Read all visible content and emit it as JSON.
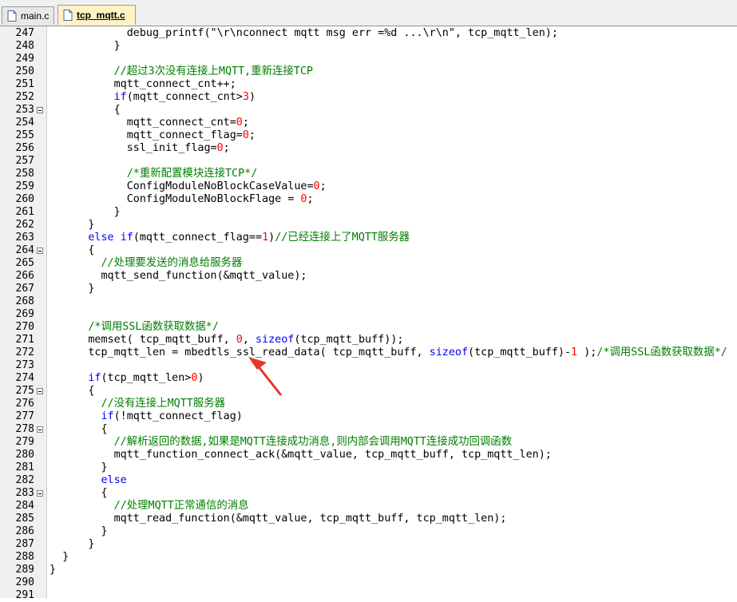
{
  "tabs": [
    {
      "label": "main.c",
      "icon": "file-icon",
      "active": false
    },
    {
      "label": "tcp_mqtt.c",
      "icon": "file-icon",
      "active": true
    }
  ],
  "colors": {
    "keyword": "#0000ff",
    "number": "#ff0000",
    "comment": "#008000",
    "arrow": "#e8332c"
  },
  "lines": [
    {
      "n": "247",
      "fold": false,
      "t": [
        [
          "            debug_printf(\"\\r\\nconnect mqtt msg err =%d ...\\r\\n\", tcp_mqtt_len);",
          ""
        ]
      ]
    },
    {
      "n": "248",
      "fold": false,
      "t": [
        [
          "          }",
          ""
        ]
      ]
    },
    {
      "n": "249",
      "fold": false,
      "t": [
        [
          "",
          ""
        ]
      ]
    },
    {
      "n": "250",
      "fold": false,
      "t": [
        [
          "          ",
          ""
        ],
        [
          "//超过3次没有连接上MQTT,重新连接TCP",
          "cm"
        ]
      ]
    },
    {
      "n": "251",
      "fold": false,
      "t": [
        [
          "          mqtt_connect_cnt++;",
          ""
        ]
      ]
    },
    {
      "n": "252",
      "fold": false,
      "t": [
        [
          "          ",
          ""
        ],
        [
          "if",
          "kw"
        ],
        [
          "(mqtt_connect_cnt>",
          ""
        ],
        [
          "3",
          "num"
        ],
        [
          ")",
          ""
        ]
      ]
    },
    {
      "n": "253",
      "fold": true,
      "t": [
        [
          "          {",
          ""
        ]
      ]
    },
    {
      "n": "254",
      "fold": false,
      "t": [
        [
          "            mqtt_connect_cnt=",
          ""
        ],
        [
          "0",
          "num"
        ],
        [
          ";",
          ""
        ]
      ]
    },
    {
      "n": "255",
      "fold": false,
      "t": [
        [
          "            mqtt_connect_flag=",
          ""
        ],
        [
          "0",
          "num"
        ],
        [
          ";",
          ""
        ]
      ]
    },
    {
      "n": "256",
      "fold": false,
      "t": [
        [
          "            ssl_init_flag=",
          ""
        ],
        [
          "0",
          "num"
        ],
        [
          ";",
          ""
        ]
      ]
    },
    {
      "n": "257",
      "fold": false,
      "t": [
        [
          "",
          ""
        ]
      ]
    },
    {
      "n": "258",
      "fold": false,
      "t": [
        [
          "            ",
          ""
        ],
        [
          "/*重新配置模块连接TCP*/",
          "cm"
        ]
      ]
    },
    {
      "n": "259",
      "fold": false,
      "t": [
        [
          "            ConfigModuleNoBlockCaseValue=",
          ""
        ],
        [
          "0",
          "num"
        ],
        [
          ";",
          ""
        ]
      ]
    },
    {
      "n": "260",
      "fold": false,
      "t": [
        [
          "            ConfigModuleNoBlockFlage = ",
          ""
        ],
        [
          "0",
          "num"
        ],
        [
          ";",
          ""
        ]
      ]
    },
    {
      "n": "261",
      "fold": false,
      "t": [
        [
          "          }",
          ""
        ]
      ]
    },
    {
      "n": "262",
      "fold": false,
      "t": [
        [
          "      }",
          ""
        ]
      ]
    },
    {
      "n": "263",
      "fold": false,
      "t": [
        [
          "      ",
          ""
        ],
        [
          "else",
          "kw"
        ],
        [
          " ",
          ""
        ],
        [
          "if",
          "kw"
        ],
        [
          "(mqtt_connect_flag==",
          ""
        ],
        [
          "1",
          "num"
        ],
        [
          ")",
          ""
        ],
        [
          "//已经连接上了MQTT服务器",
          "cm"
        ]
      ]
    },
    {
      "n": "264",
      "fold": true,
      "t": [
        [
          "      {",
          ""
        ]
      ]
    },
    {
      "n": "265",
      "fold": false,
      "t": [
        [
          "        ",
          ""
        ],
        [
          "//处理要发送的消息给服务器",
          "cm"
        ]
      ]
    },
    {
      "n": "266",
      "fold": false,
      "t": [
        [
          "        mqtt_send_function(&mqtt_value);",
          ""
        ]
      ]
    },
    {
      "n": "267",
      "fold": false,
      "t": [
        [
          "      }",
          ""
        ]
      ]
    },
    {
      "n": "268",
      "fold": false,
      "t": [
        [
          "",
          ""
        ]
      ]
    },
    {
      "n": "269",
      "fold": false,
      "t": [
        [
          "",
          ""
        ]
      ]
    },
    {
      "n": "270",
      "fold": false,
      "t": [
        [
          "      ",
          ""
        ],
        [
          "/*调用SSL函数获取数据*/",
          "cm"
        ]
      ]
    },
    {
      "n": "271",
      "fold": false,
      "t": [
        [
          "      memset( tcp_mqtt_buff, ",
          ""
        ],
        [
          "0",
          "num"
        ],
        [
          ", ",
          ""
        ],
        [
          "sizeof",
          "kw"
        ],
        [
          "(tcp_mqtt_buff));",
          ""
        ]
      ]
    },
    {
      "n": "272",
      "fold": false,
      "t": [
        [
          "      tcp_mqtt_len = mbedtls_ssl_read_data( tcp_mqtt_buff, ",
          ""
        ],
        [
          "sizeof",
          "kw"
        ],
        [
          "(tcp_mqtt_buff)-",
          ""
        ],
        [
          "1",
          "num"
        ],
        [
          " );",
          ""
        ],
        [
          "/*调用SSL函数获取数据*/",
          "cm"
        ]
      ]
    },
    {
      "n": "273",
      "fold": false,
      "t": [
        [
          "",
          ""
        ]
      ]
    },
    {
      "n": "274",
      "fold": false,
      "t": [
        [
          "      ",
          ""
        ],
        [
          "if",
          "kw"
        ],
        [
          "(tcp_mqtt_len>",
          ""
        ],
        [
          "0",
          "num"
        ],
        [
          ")",
          ""
        ]
      ]
    },
    {
      "n": "275",
      "fold": true,
      "t": [
        [
          "      {",
          ""
        ]
      ]
    },
    {
      "n": "276",
      "fold": false,
      "t": [
        [
          "        ",
          ""
        ],
        [
          "//没有连接上MQTT服务器",
          "cm"
        ]
      ]
    },
    {
      "n": "277",
      "fold": false,
      "t": [
        [
          "        ",
          ""
        ],
        [
          "if",
          "kw"
        ],
        [
          "(!mqtt_connect_flag)",
          ""
        ]
      ]
    },
    {
      "n": "278",
      "fold": true,
      "t": [
        [
          "        {",
          ""
        ]
      ]
    },
    {
      "n": "279",
      "fold": false,
      "t": [
        [
          "          ",
          ""
        ],
        [
          "//解析返回的数据,如果是MQTT连接成功消息,则内部会调用MQTT连接成功回调函数",
          "cm"
        ]
      ]
    },
    {
      "n": "280",
      "fold": false,
      "t": [
        [
          "          mqtt_function_connect_ack(&mqtt_value, tcp_mqtt_buff, tcp_mqtt_len);",
          ""
        ]
      ]
    },
    {
      "n": "281",
      "fold": false,
      "t": [
        [
          "        }",
          ""
        ]
      ]
    },
    {
      "n": "282",
      "fold": false,
      "t": [
        [
          "        ",
          ""
        ],
        [
          "else",
          "kw"
        ]
      ]
    },
    {
      "n": "283",
      "fold": true,
      "t": [
        [
          "        {",
          ""
        ]
      ]
    },
    {
      "n": "284",
      "fold": false,
      "t": [
        [
          "          ",
          ""
        ],
        [
          "//处理MQTT正常通信的消息",
          "cm"
        ]
      ]
    },
    {
      "n": "285",
      "fold": false,
      "t": [
        [
          "          mqtt_read_function(&mqtt_value, tcp_mqtt_buff, tcp_mqtt_len);",
          ""
        ]
      ]
    },
    {
      "n": "286",
      "fold": false,
      "t": [
        [
          "        }",
          ""
        ]
      ]
    },
    {
      "n": "287",
      "fold": false,
      "t": [
        [
          "      }",
          ""
        ]
      ]
    },
    {
      "n": "288",
      "fold": false,
      "t": [
        [
          "  }",
          ""
        ]
      ]
    },
    {
      "n": "289",
      "fold": false,
      "t": [
        [
          "}",
          ""
        ]
      ]
    },
    {
      "n": "290",
      "fold": false,
      "t": [
        [
          "",
          ""
        ]
      ]
    },
    {
      "n": "291",
      "fold": false,
      "t": [
        [
          "",
          ""
        ]
      ]
    }
  ]
}
